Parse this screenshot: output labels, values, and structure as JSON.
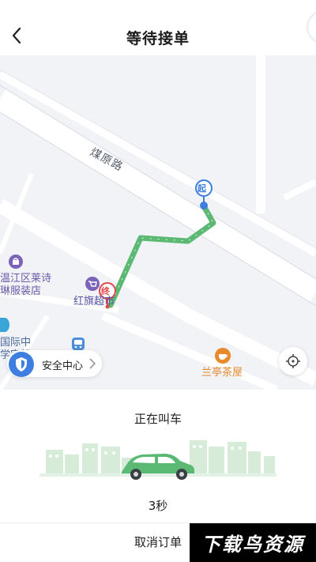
{
  "header": {
    "title": "等待接单"
  },
  "map": {
    "road_label": "煤原路",
    "pois": {
      "clothing_store_line1": "温江区莱诗",
      "clothing_store_line2": "琳服装店",
      "supermarket": "红旗超市",
      "school_line1": "国际中",
      "school_line2": "学字机",
      "teahouse": "兰亭茶屋"
    },
    "start_marker": "起",
    "end_marker": "终",
    "route_color": "#5bb974",
    "safety_center_label": "安全中心"
  },
  "panel": {
    "status_text": "正在叫车",
    "timer_text": "3秒",
    "cancel_label": "取消订单"
  },
  "watermark": {
    "text": "下载鸟资源"
  }
}
